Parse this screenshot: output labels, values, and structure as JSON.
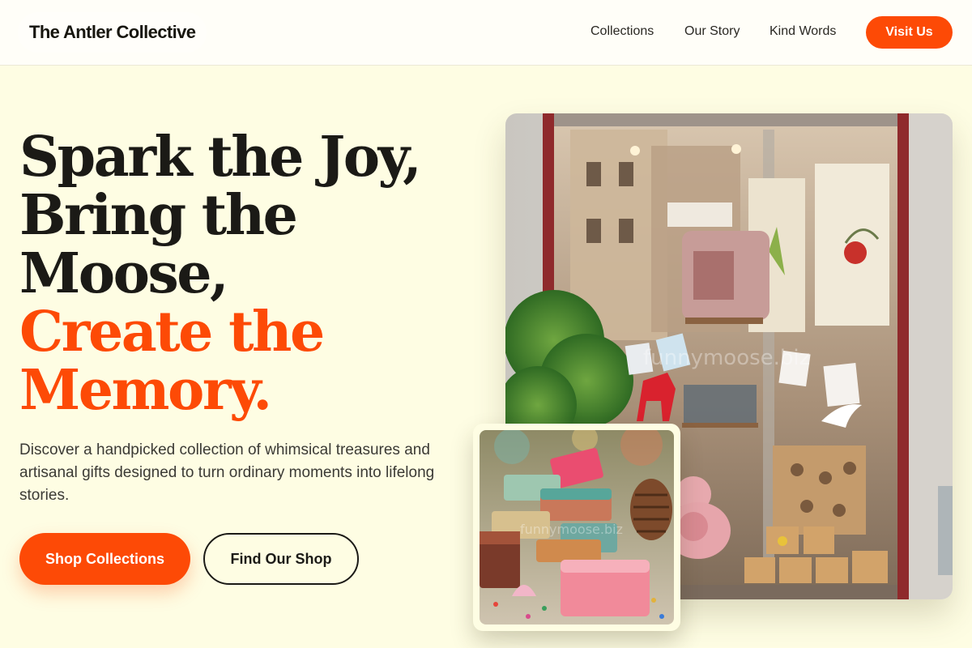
{
  "header": {
    "brand": "The Antler Collective",
    "nav": {
      "collections": "Collections",
      "our_story": "Our Story",
      "kind_words": "Kind Words"
    },
    "cta_label": "Visit Us"
  },
  "hero": {
    "title_lines": [
      "Spark the Joy,",
      "Bring the",
      "Moose,"
    ],
    "title_accent_lines": [
      "Create the",
      "Memory."
    ],
    "description": "Discover a handpicked collection of whimsical treasures and artisanal gifts designed to turn ordinary moments into lifelong stories.",
    "primary_button": "Shop Collections",
    "secondary_button": "Find Our Shop"
  },
  "images": {
    "main_watermark": "funnymoose.biz",
    "small_watermark": "funnymoose.biz"
  },
  "colors": {
    "accent": "#fd4a06",
    "background": "#fefde3",
    "header_bg": "#fffef8",
    "text": "#1b1a16"
  }
}
